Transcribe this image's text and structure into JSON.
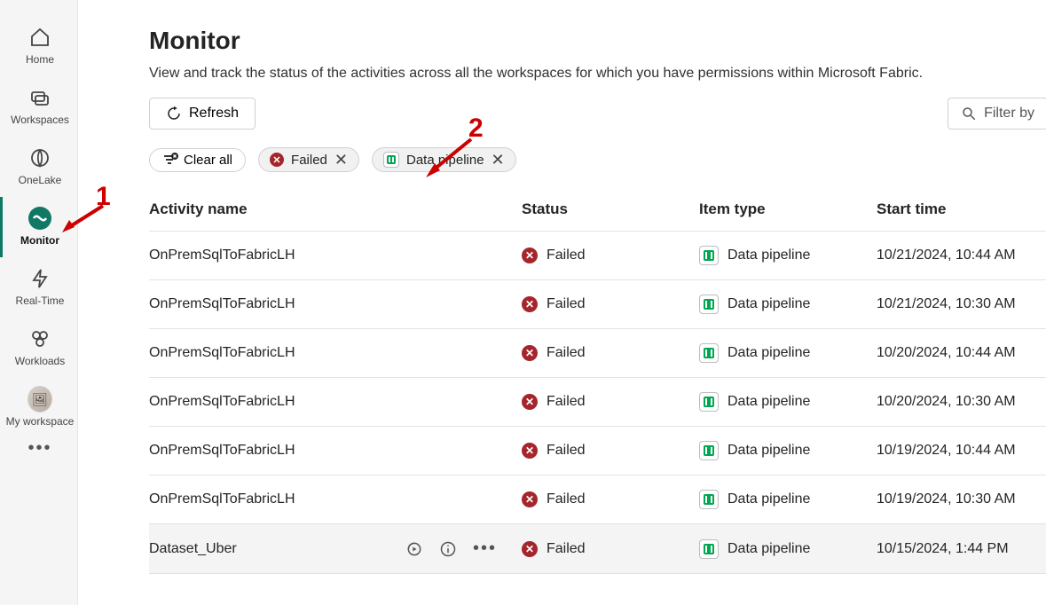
{
  "sidebar": {
    "items": [
      {
        "label": "Home"
      },
      {
        "label": "Workspaces"
      },
      {
        "label": "OneLake"
      },
      {
        "label": "Monitor"
      },
      {
        "label": "Real-Time"
      },
      {
        "label": "Workloads"
      },
      {
        "label": "My workspace"
      }
    ]
  },
  "page": {
    "title": "Monitor",
    "description": "View and track the status of the activities across all the workspaces for which you have permissions within Microsoft Fabric."
  },
  "toolbar": {
    "refresh": "Refresh",
    "filter_placeholder": "Filter by"
  },
  "chips": {
    "clear_all": "Clear all",
    "failed": "Failed",
    "pipeline": "Data pipeline"
  },
  "table": {
    "headers": {
      "name": "Activity name",
      "status": "Status",
      "type": "Item type",
      "start": "Start time"
    },
    "rows": [
      {
        "name": "OnPremSqlToFabricLH",
        "status": "Failed",
        "type": "Data pipeline",
        "start": "10/21/2024, 10:44 AM",
        "hover": false
      },
      {
        "name": "OnPremSqlToFabricLH",
        "status": "Failed",
        "type": "Data pipeline",
        "start": "10/21/2024, 10:30 AM",
        "hover": false
      },
      {
        "name": "OnPremSqlToFabricLH",
        "status": "Failed",
        "type": "Data pipeline",
        "start": "10/20/2024, 10:44 AM",
        "hover": false
      },
      {
        "name": "OnPremSqlToFabricLH",
        "status": "Failed",
        "type": "Data pipeline",
        "start": "10/20/2024, 10:30 AM",
        "hover": false
      },
      {
        "name": "OnPremSqlToFabricLH",
        "status": "Failed",
        "type": "Data pipeline",
        "start": "10/19/2024, 10:44 AM",
        "hover": false
      },
      {
        "name": "OnPremSqlToFabricLH",
        "status": "Failed",
        "type": "Data pipeline",
        "start": "10/19/2024, 10:30 AM",
        "hover": false
      },
      {
        "name": "Dataset_Uber",
        "status": "Failed",
        "type": "Data pipeline",
        "start": "10/15/2024, 1:44 PM",
        "hover": true
      }
    ]
  },
  "annotations": {
    "a1": "1",
    "a2": "2"
  }
}
